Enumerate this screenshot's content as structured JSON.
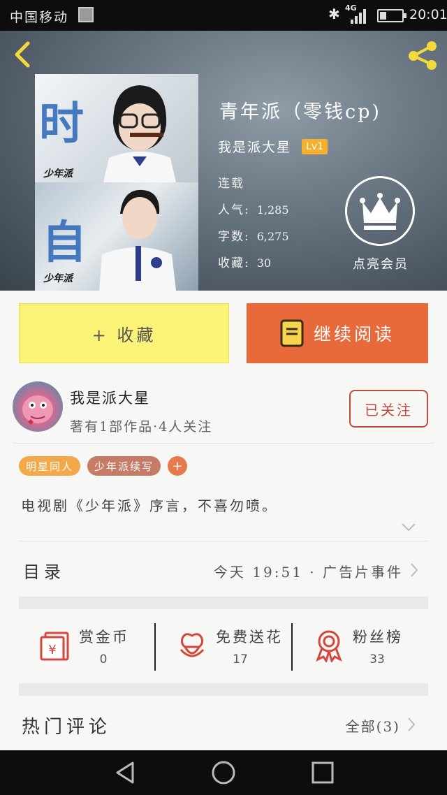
{
  "status_bar": {
    "carrier": "中国移动",
    "network": "4G",
    "time": "20:01"
  },
  "book": {
    "title": "青年派（零钱cp)",
    "author": "我是派大星",
    "level_badge": "Lv1",
    "status": "连载",
    "popularity_label": "人气:",
    "popularity_value": "1,285",
    "words_label": "字数:",
    "words_value": "6,275",
    "favorites_label": "收藏:",
    "favorites_value": "30",
    "cover_text_top": "时",
    "cover_text_bottom": "自",
    "cover_watermark": "少年派"
  },
  "vip": {
    "label": "点亮会员"
  },
  "actions": {
    "collect_label": "+ 收藏",
    "read_label": "继续阅读"
  },
  "author_block": {
    "name": "我是派大星",
    "stats": "著有1部作品·4人关注",
    "follow_label": "已关注"
  },
  "tags": [
    {
      "label": "明星同人"
    },
    {
      "label": "少年派续写"
    },
    {
      "label": "+"
    }
  ],
  "intro": "电视剧《少年派》序言，不喜勿喷。",
  "toc": {
    "label": "目录",
    "update": "今天 19:51 · 广告片事件"
  },
  "stats": [
    {
      "label": "赏金币",
      "value": "0",
      "icon": "gold-coin-icon"
    },
    {
      "label": "免费送花",
      "value": "17",
      "icon": "flower-icon"
    },
    {
      "label": "粉丝榜",
      "value": "33",
      "icon": "fan-ranking-icon"
    }
  ],
  "comments": {
    "label": "热门评论",
    "all_label": "全部(3)"
  },
  "colors": {
    "collect_bg": "#fbf378",
    "read_bg": "#e8693a",
    "follow_border": "#c64a3c",
    "icon_red": "#d8453a",
    "lv_badge": "#f5b02e"
  }
}
